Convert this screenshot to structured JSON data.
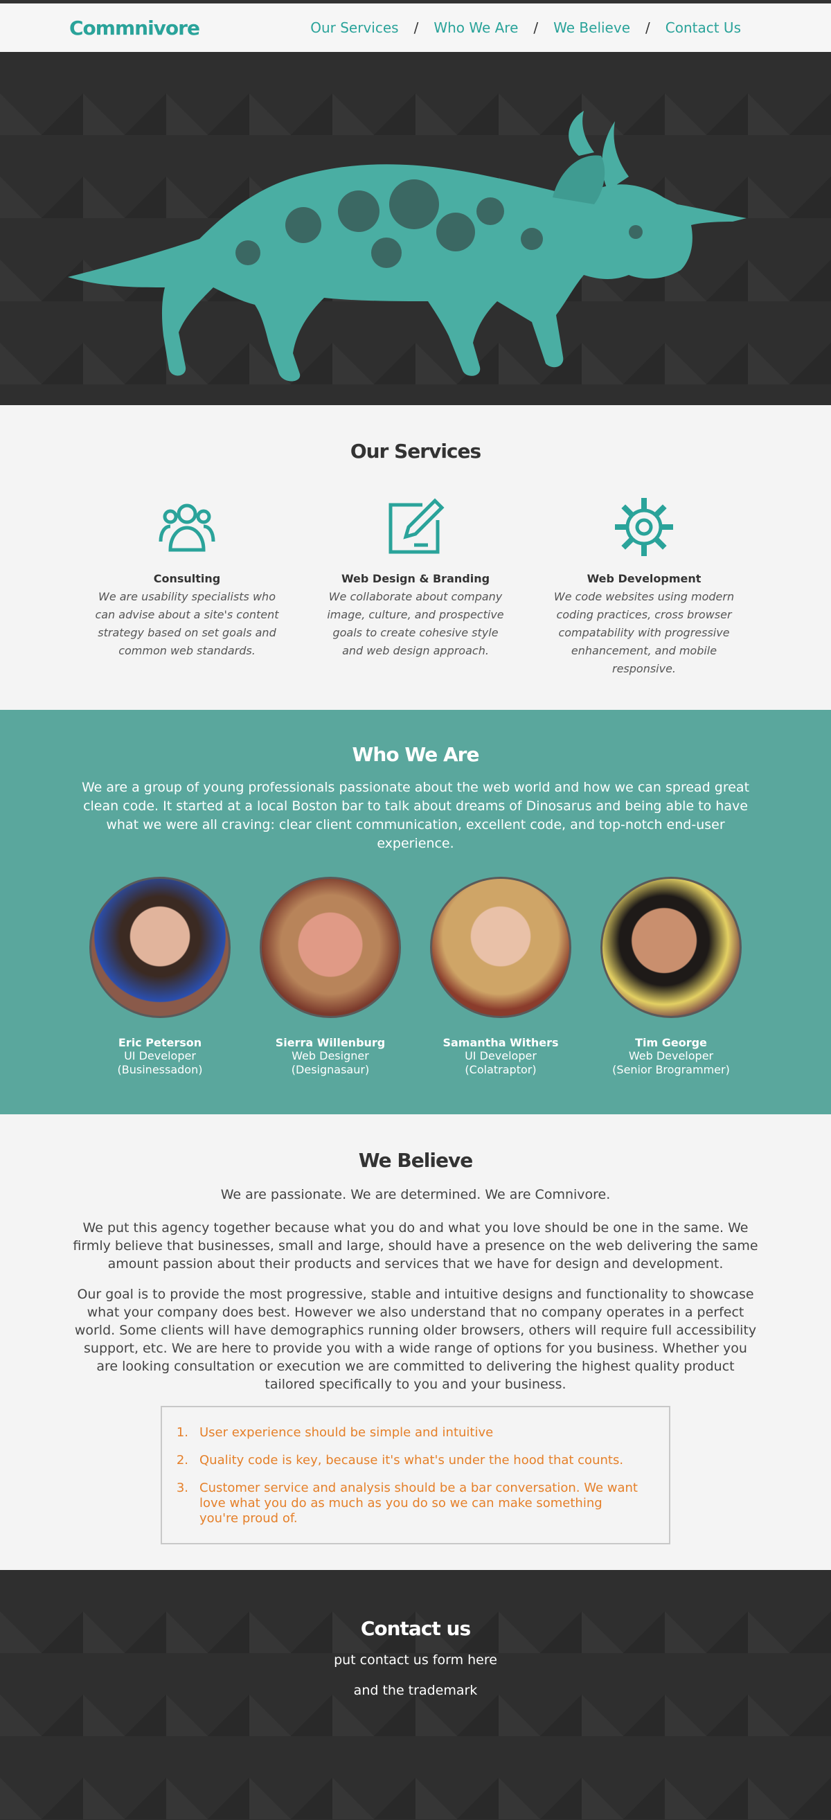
{
  "brand": {
    "logo": "Commnivore",
    "accent": "#2aa39a",
    "teal_bg": "#5aa79d",
    "orange": "#e5802a"
  },
  "nav": {
    "items": [
      {
        "label": "Our Services"
      },
      {
        "label": "Who We Are"
      },
      {
        "label": "We Believe"
      },
      {
        "label": "Contact Us"
      }
    ],
    "separator": "/"
  },
  "hero": {
    "image": "triceratops-illustration"
  },
  "services": {
    "title": "Our Services",
    "items": [
      {
        "icon": "people-icon",
        "title": "Consulting",
        "desc": "We are usability specialists who can advise about a site's content strategy based on set goals and common web standards."
      },
      {
        "icon": "edit-icon",
        "title": "Web Design & Branding",
        "desc": "We collaborate about company image, culture, and prospective goals to create cohesive style and web design approach."
      },
      {
        "icon": "gear-icon",
        "title": "Web Development",
        "desc": "We code websites using modern coding practices, cross browser compatability with progressive enhancement, and mobile responsive."
      }
    ]
  },
  "who": {
    "title": "Who We Are",
    "intro": "We are a group of young professionals passionate about the web world and how we can spread great clean code. It started at a local Boston bar to talk about dreams of Dinosarus and being able to have what we were all craving: clear client communication, excellent code, and top-notch end-user experience.",
    "team": [
      {
        "name": "Eric Peterson",
        "role": "UI Developer",
        "alias": "(Businessadon)"
      },
      {
        "name": "Sierra Willenburg",
        "role": "Web Designer",
        "alias": "(Designasaur)"
      },
      {
        "name": "Samantha Withers",
        "role": "UI Developer",
        "alias": "(Colatraptor)"
      },
      {
        "name": "Tim George",
        "role": "Web Developer",
        "alias": "(Senior Brogrammer)"
      }
    ]
  },
  "believe": {
    "title": "We Believe",
    "lead": "We are passionate. We are determined. We are Comnivore.",
    "p1": "We put this agency together because what you do and what you love should be one in the same. We firmly believe that businesses, small and large, should have a presence on the web delivering the same amount passion about their products and services that we have for design and development.",
    "p2": "Our goal is to provide the most progressive, stable and intuitive designs and functionality to showcase what your company does best. However we also understand that no company operates in a perfect world. Some clients will have demographics running older browsers, others will require full accessibility support, etc. We are here to provide you with a wide range of options for you business. Whether you are looking consultation or execution we are committed to delivering the highest quality product tailored specifically to you and your business.",
    "goals": [
      {
        "num": "1.",
        "text": "User experience should be simple and intuitive"
      },
      {
        "num": "2.",
        "text": "Quality code is key, because it's what's under the hood that counts."
      },
      {
        "num": "3.",
        "text": "Customer service and analysis should be a bar conversation. We want love what you do as much as you do so we can make something you're proud of."
      }
    ]
  },
  "contact": {
    "title": "Contact us",
    "line1": "put contact us form here",
    "line2": "and the trademark"
  }
}
